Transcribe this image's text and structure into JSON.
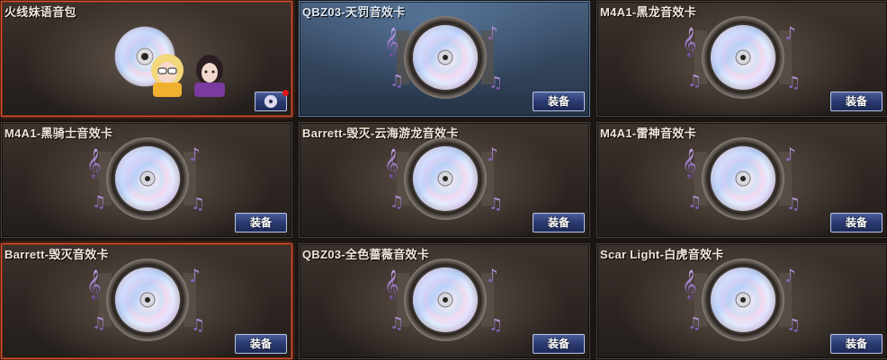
{
  "cards": [
    {
      "title": "火线妹语音包",
      "button": "",
      "icon": "disc-icon",
      "state": "selected"
    },
    {
      "title": "QBZ03-天罚音效卡",
      "button": "装备",
      "icon": "speaker-icon",
      "state": "highlight"
    },
    {
      "title": "M4A1-黑龙音效卡",
      "button": "装备",
      "icon": "speaker-icon",
      "state": "normal"
    },
    {
      "title": "M4A1-黑骑士音效卡",
      "button": "装备",
      "icon": "speaker-icon",
      "state": "normal"
    },
    {
      "title": "Barrett-毁灭-云海游龙音效卡",
      "button": "装备",
      "icon": "speaker-icon",
      "state": "normal"
    },
    {
      "title": "M4A1-雷神音效卡",
      "button": "装备",
      "icon": "speaker-icon",
      "state": "normal"
    },
    {
      "title": "Barrett-毁灭音效卡",
      "button": "装备",
      "icon": "speaker-icon",
      "state": "selected"
    },
    {
      "title": "QBZ03-全色蔷薇音效卡",
      "button": "装备",
      "icon": "speaker-icon",
      "state": "normal"
    },
    {
      "title": "Scar Light-白虎音效卡",
      "button": "装备",
      "icon": "speaker-icon",
      "state": "normal"
    }
  ],
  "colors": {
    "selected_border": "#d8542f",
    "button_bg": "#2b3a70",
    "notification_dot": "#e01818"
  }
}
